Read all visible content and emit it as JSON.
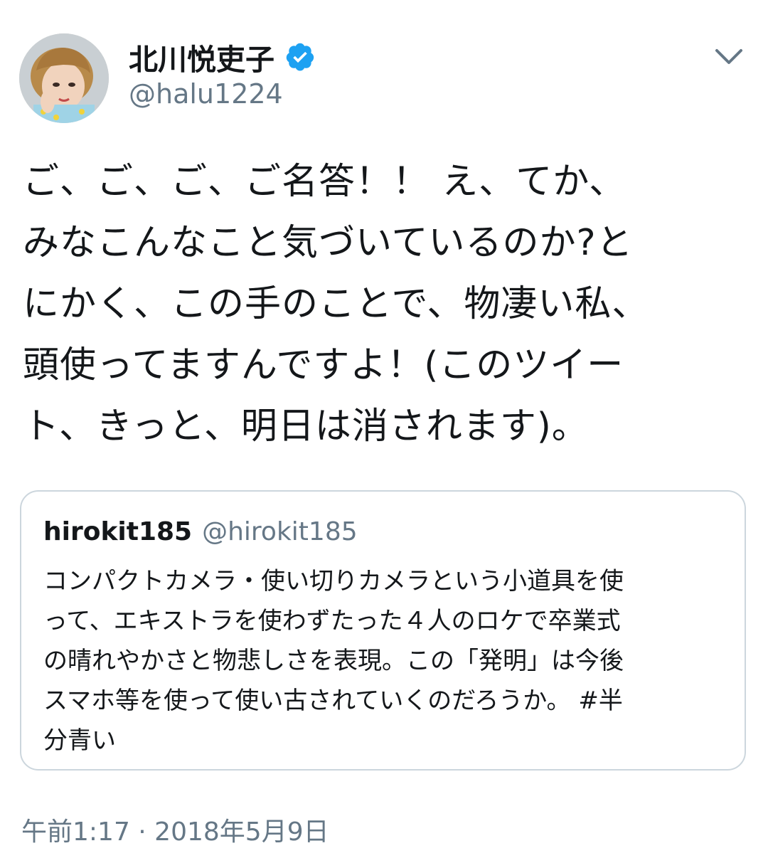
{
  "colors": {
    "text": "#14171a",
    "secondary": "#657786",
    "verified": "#1da1f2",
    "border": "#ccd6dd"
  },
  "author": {
    "display_name": "北川悦吏子",
    "handle": "@halu1224",
    "verified": true
  },
  "tweet": {
    "text": "ご、ご、ご、ご名答！！ え、てか、\nみなこんなこと気づいているのか?と\nにかく、この手のことで、物凄い私、\n頭使ってますんですよ！(このツイー\nト、きっと、明日は消されます)。"
  },
  "quote": {
    "display_name": "hirokit185",
    "handle": "@hirokit185",
    "text": "コンパクトカメラ・使い切りカメラという小道具を使\nって、エキストラを使わずたった４人のロケで卒業式\nの晴れやかさと物悲しさを表現。この「発明」は今後\nスマホ等を使って使い古されていくのだろうか。 #半\n分青い"
  },
  "timestamp": "午前1:17 · 2018年5月9日",
  "icons": {
    "verified": "verified-badge-icon",
    "menu": "chevron-down-icon"
  }
}
